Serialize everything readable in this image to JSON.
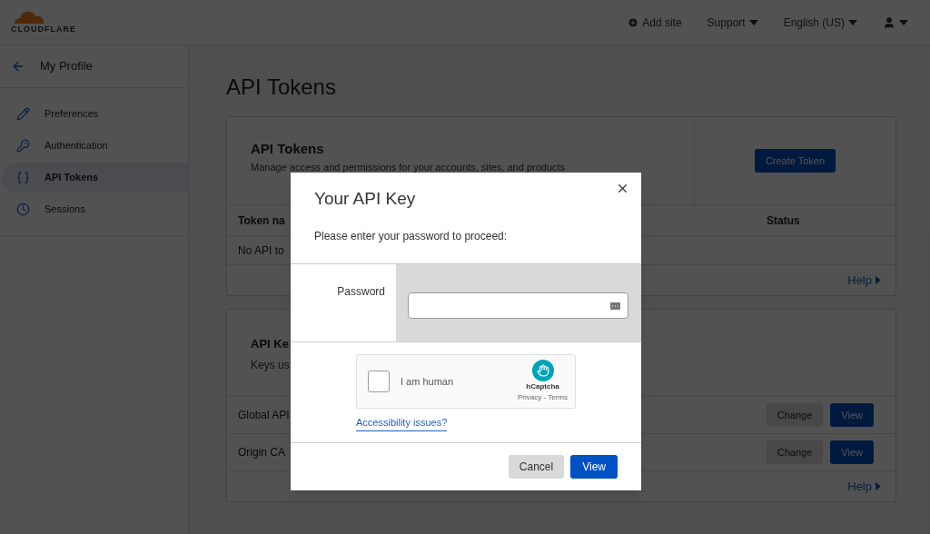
{
  "header": {
    "logo": "CLOUDFLARE",
    "nav": [
      {
        "label": "Add site",
        "kind": "add"
      },
      {
        "label": "Support",
        "kind": "menu"
      },
      {
        "label": "English (US)",
        "kind": "menu"
      },
      {
        "kind": "user"
      }
    ]
  },
  "sidebar": {
    "back": "My Profile",
    "items": [
      {
        "label": "Preferences",
        "selected": false
      },
      {
        "label": "Authentication",
        "selected": false
      },
      {
        "label": "API Tokens",
        "selected": true
      },
      {
        "label": "Sessions",
        "selected": false
      }
    ]
  },
  "page_title": "API Tokens",
  "tokens_card": {
    "title": "API Tokens",
    "description": "Manage access and permissions for your accounts, sites, and products",
    "button": "Create Token",
    "columns": [
      "Token na",
      "Status"
    ],
    "empty": "No API to",
    "help": "Help"
  },
  "keys_card": {
    "title": "API Ke",
    "description": "Keys us",
    "rows": [
      {
        "name": "Global API",
        "actions": [
          "Change",
          "View"
        ]
      },
      {
        "name": "Origin CA",
        "actions": [
          "Change",
          "View"
        ]
      }
    ],
    "help": "Help"
  },
  "dialog": {
    "title": "Your API Key",
    "message": "Please enter your password to proceed:",
    "field_label": "Password",
    "captcha": {
      "label": "I am human",
      "checked": false,
      "brand": "hCaptcha",
      "links": "Privacy - Terms"
    },
    "link": "Accessibility issues?",
    "buttons": [
      {
        "label": "Cancel",
        "kind": "secondary"
      },
      {
        "label": "View",
        "kind": "primary"
      }
    ]
  }
}
